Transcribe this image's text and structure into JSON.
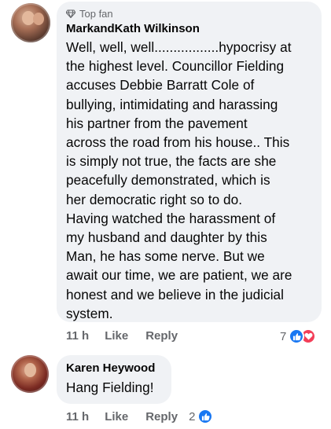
{
  "comments": [
    {
      "badge": "Top fan",
      "author": "MarkandKath Wilkinson",
      "text": "Well, well, well.................hypocrisy at\nthe highest level. Councillor Fielding\naccuses Debbie Barratt Cole of\nbullying, intimidating and harassing\nhis partner from the pavement\nacross the road from his house.. This\nis simply not true, the facts are she\npeacefully demonstrated, which is\nher democratic right so to do.\nHaving watched the harassment of\nmy husband and daughter by this\nMan, he has some nerve. But we\nawait our time, we are patient, we are\nhonest and we believe in the judicial\nsystem.",
      "time": "11 h",
      "like": "Like",
      "reply": "Reply",
      "reaction_count": "7",
      "reactions": [
        "like-icon",
        "love-icon"
      ]
    },
    {
      "author": "Karen Heywood",
      "text": "Hang Fielding!",
      "time": "11 h",
      "like": "Like",
      "reply": "Reply",
      "reaction_count": "2",
      "reactions": [
        "like-icon"
      ]
    }
  ],
  "colors": {
    "bubble": "#f0f2f5",
    "secondary_text": "#65676b",
    "like_blue": "#1877f2",
    "love_red": "#f33e58"
  }
}
